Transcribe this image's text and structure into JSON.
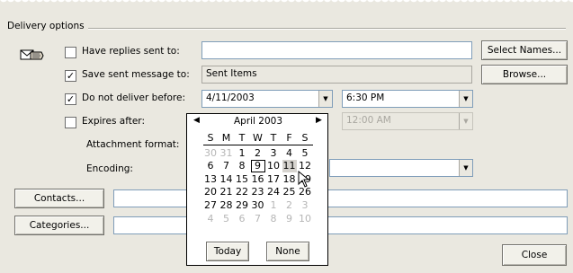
{
  "group_title": "Delivery options",
  "fields": {
    "have_replies_label": "Have replies sent to:",
    "have_replies_value": "",
    "save_sent_label": "Save sent message to:",
    "save_sent_value": "Sent Items",
    "do_not_deliver_label": "Do not deliver before:",
    "do_not_deliver_date": "4/11/2003",
    "do_not_deliver_time": "6:30 PM",
    "expires_label": "Expires after:",
    "expires_time": "12:00 AM",
    "attachment_label": "Attachment format:",
    "encoding_label": "Encoding:",
    "contacts_value": "",
    "categories_value": ""
  },
  "checkboxes": {
    "have_replies": false,
    "save_sent": true,
    "do_not_deliver": true,
    "expires": false
  },
  "buttons": {
    "select_names": "Select Names...",
    "browse": "Browse...",
    "contacts": "Contacts...",
    "categories": "Categories...",
    "close": "Close"
  },
  "calendar": {
    "month_label": "April 2003",
    "weekdays": [
      "S",
      "M",
      "T",
      "W",
      "T",
      "F",
      "S"
    ],
    "days": [
      [
        "30",
        "31",
        "1",
        "2",
        "3",
        "4",
        "5"
      ],
      [
        "6",
        "7",
        "8",
        "9",
        "10",
        "11",
        "12"
      ],
      [
        "13",
        "14",
        "15",
        "16",
        "17",
        "18",
        "19"
      ],
      [
        "20",
        "21",
        "22",
        "23",
        "24",
        "25",
        "26"
      ],
      [
        "27",
        "28",
        "29",
        "30",
        "1",
        "2",
        "3"
      ],
      [
        "4",
        "5",
        "6",
        "7",
        "8",
        "9",
        "10"
      ]
    ],
    "today_label": "Today",
    "none_label": "None"
  },
  "icons": {
    "options": "hand-envelope-icon",
    "check": "checkmark-icon",
    "dropdown": "chevron-down-icon"
  }
}
